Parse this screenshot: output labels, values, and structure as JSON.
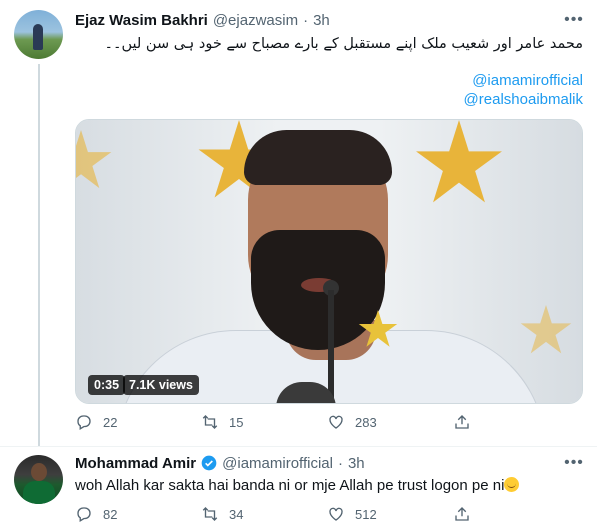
{
  "tweet1": {
    "author_name": "Ejaz Wasim Bakhri",
    "handle": "@ejazwasim",
    "separator": "·",
    "time": "3h",
    "more_icon": "more-horizontal-icon",
    "text_urdu": "محمد عامر اور شعیب ملک اپنے مستقبل کے بارے مصباح سے خود ہی سن لیں۔۔",
    "mentions": [
      "@iamamirofficial",
      "@realshoaibmalik"
    ],
    "video": {
      "duration": "0:35",
      "views": "7.1K views"
    },
    "actions": {
      "reply_count": "22",
      "retweet_count": "15",
      "like_count": "283"
    }
  },
  "tweet2": {
    "author_name": "Mohammad Amir",
    "handle": "@iamamirofficial",
    "separator": "·",
    "time": "3h",
    "verified": true,
    "more_icon": "more-horizontal-icon",
    "text": "woh Allah kar sakta hai banda ni or mje Allah pe trust logon pe ni",
    "emoji": "smiling-face-emoji",
    "actions": {
      "reply_count": "82",
      "retweet_count": "34",
      "like_count": "512"
    }
  },
  "colors": {
    "link": "#1d9bf0",
    "muted": "#536471",
    "verified": "#1d9bf0",
    "star": "#e8b43a"
  }
}
